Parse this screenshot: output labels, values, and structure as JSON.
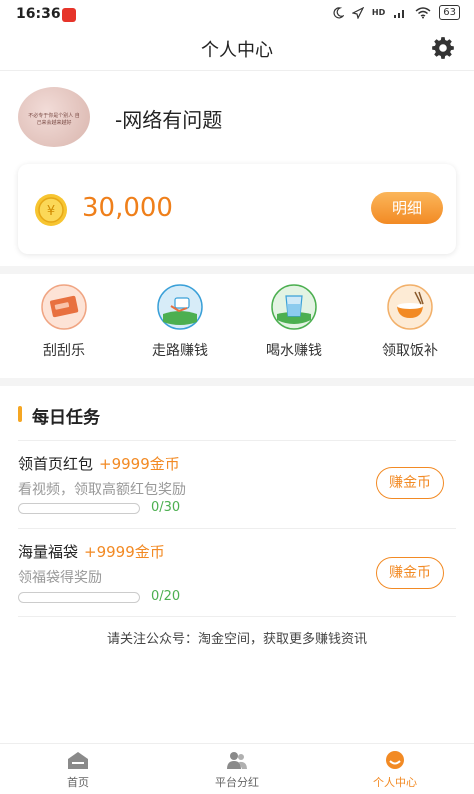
{
  "status_bar": {
    "time": "16:36",
    "signal": "HD",
    "battery": "63"
  },
  "header": {
    "title": "个人中心"
  },
  "profile": {
    "username": "-网络有问题",
    "avatar_caption": "不必专于你是个别人 自己来会越来越好"
  },
  "coins": {
    "amount": "30,000",
    "detail_label": "明细"
  },
  "actions": [
    {
      "label": "刮刮乐",
      "icon": "scratch-card-icon",
      "color": "#e8703f"
    },
    {
      "label": "走路赚钱",
      "icon": "walking-icon",
      "color": "#3aa0d8"
    },
    {
      "label": "喝水赚钱",
      "icon": "water-glass-icon",
      "color": "#4caf50"
    },
    {
      "label": "领取饭补",
      "icon": "meal-bowl-icon",
      "color": "#f28a24"
    }
  ],
  "tasks": {
    "title": "每日任务",
    "items": [
      {
        "name": "领首页红包",
        "reward": "+9999金币",
        "desc": "看视频，领取高额红包奖励",
        "progress_text": "0/30",
        "progress": 0.0,
        "button": "赚金币"
      },
      {
        "name": "海量福袋",
        "reward": "+9999金币",
        "desc": "领福袋得奖励",
        "progress_text": "0/20",
        "progress": 0.0,
        "button": "赚金币"
      }
    ]
  },
  "notice": "请关注公众号：淘金空间，获取更多赚钱资讯",
  "nav": [
    {
      "label": "首页",
      "icon": "home-icon",
      "active": false
    },
    {
      "label": "平台分红",
      "icon": "users-icon",
      "active": false
    },
    {
      "label": "个人中心",
      "icon": "profile-icon",
      "active": true
    }
  ],
  "colors": {
    "accent": "#f28a24",
    "progress": "#4caf50"
  }
}
